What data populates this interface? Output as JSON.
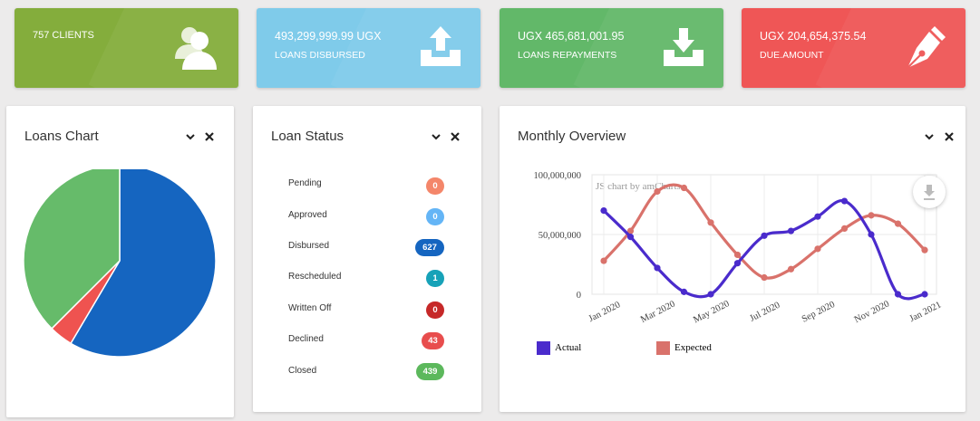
{
  "stats": {
    "clients": {
      "value": "757 CLIENTS",
      "color": "#84ad3c",
      "icon": "users-icon"
    },
    "disbursed": {
      "value": "493,299,999.99 UGX",
      "label": "LOANS DISBURSED",
      "color": "#7fcbea",
      "icon": "upload-tray-icon"
    },
    "repayments": {
      "value": "UGX 465,681,001.95",
      "label": "LOANS REPAYMENTS",
      "color": "#62b869",
      "icon": "download-tray-icon"
    },
    "due": {
      "value": "UGX 204,654,375.54",
      "label": "DUE.AMOUNT",
      "color": "#ef5656",
      "icon": "pen-nib-icon"
    }
  },
  "loans_chart": {
    "title": "Loans Chart",
    "slices": [
      {
        "value": 58.5,
        "color": "#1565c0"
      },
      {
        "value": 4.0,
        "color": "#ef5350"
      },
      {
        "value": 37.5,
        "color": "#66bb6a"
      }
    ]
  },
  "loan_status": {
    "title": "Loan Status",
    "items": [
      {
        "label": "Pending",
        "count": "0",
        "color": "#f4866a"
      },
      {
        "label": "Approved",
        "count": "0",
        "color": "#64b5f6"
      },
      {
        "label": "Disbursed",
        "count": "627",
        "color": "#1565c0"
      },
      {
        "label": "Rescheduled",
        "count": "1",
        "color": "#17a2b8"
      },
      {
        "label": "Written Off",
        "count": "0",
        "color": "#c62828"
      },
      {
        "label": "Declined",
        "count": "43",
        "color": "#e84d4d"
      },
      {
        "label": "Closed",
        "count": "439",
        "color": "#5cb85c"
      }
    ]
  },
  "monthly_overview": {
    "title": "Monthly Overview",
    "watermark": "JS chart by amCharts"
  },
  "chart_data": {
    "type": "line",
    "x": [
      "Jan 2020",
      "Feb 2020",
      "Mar 2020",
      "Apr 2020",
      "May 2020",
      "Jun 2020",
      "Jul 2020",
      "Aug 2020",
      "Sep 2020",
      "Oct 2020",
      "Nov 2020",
      "Dec 2020",
      "Jan 2021"
    ],
    "x_tick_labels": [
      "Jan 2020",
      "Mar 2020",
      "May 2020",
      "Jul 2020",
      "Sep 2020",
      "Nov 2020",
      "Jan 2021"
    ],
    "y_tick_labels": [
      "100,000,000",
      "50,000,000",
      "0"
    ],
    "ylim": [
      0,
      100000000
    ],
    "grid": true,
    "legend_position": "bottom-left",
    "series": [
      {
        "name": "Actual",
        "color": "#4a2bcc",
        "values": [
          70000000,
          48000000,
          22000000,
          2000000,
          0,
          26000000,
          49000000,
          53000000,
          65000000,
          78000000,
          50000000,
          0,
          0
        ]
      },
      {
        "name": "Expected",
        "color": "#d9726b",
        "values": [
          28000000,
          53000000,
          86000000,
          89000000,
          60000000,
          33000000,
          14000000,
          21000000,
          38000000,
          55000000,
          66000000,
          59000000,
          37000000
        ]
      }
    ]
  }
}
